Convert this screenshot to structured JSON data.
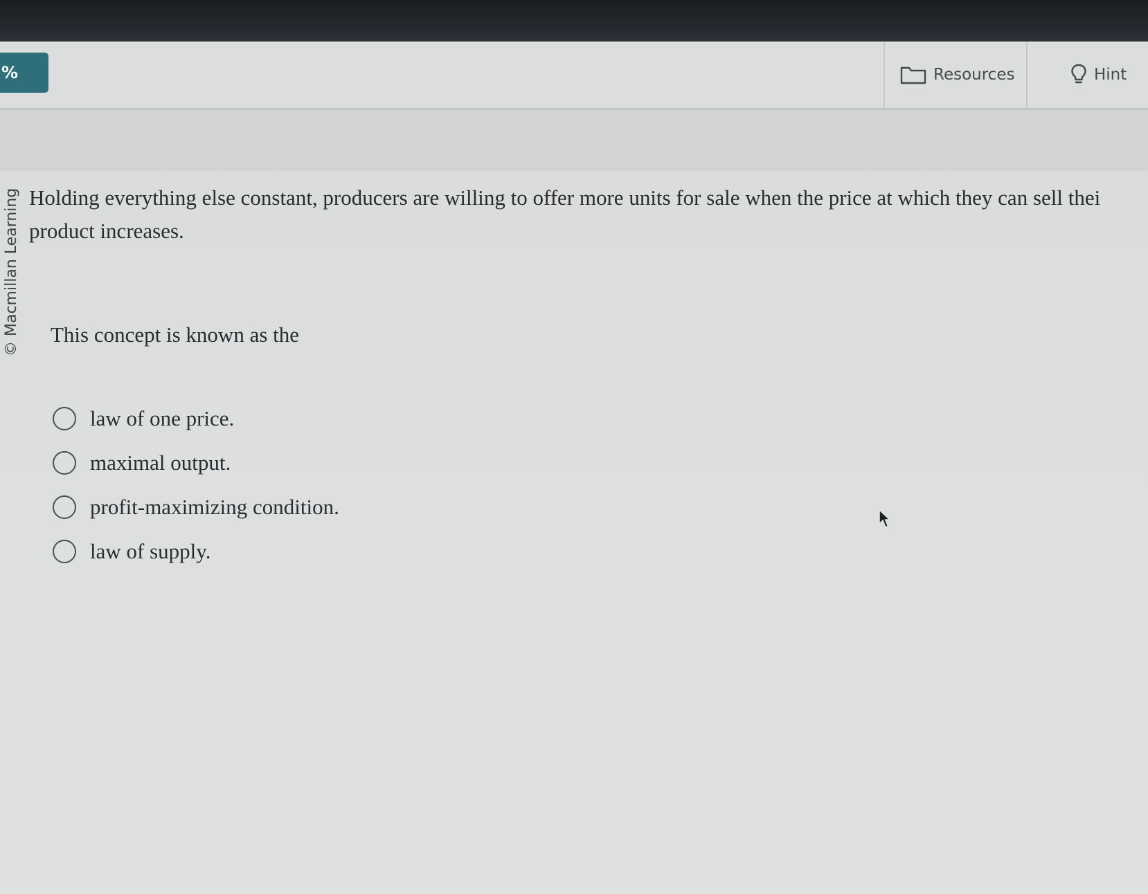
{
  "toolbar": {
    "score_label": "%",
    "resources_label": "Resources",
    "resources_icon": "folder-icon",
    "hint_label": "Hint",
    "hint_icon": "lightbulb-icon"
  },
  "credit": "© Macmillan Learning",
  "question": {
    "text": "Holding everything else constant, producers are willing to offer more units for sale when the price at which they can sell thei product increases.",
    "prompt": "This concept is known as the"
  },
  "options": [
    {
      "label": "law of one price.",
      "selected": false
    },
    {
      "label": "maximal output.",
      "selected": false
    },
    {
      "label": "profit-maximizing condition.",
      "selected": false
    },
    {
      "label": "law of supply.",
      "selected": false
    }
  ],
  "colors": {
    "accent": "#2e6f7a",
    "page_background": "#dcdede",
    "text": "#2a2d2f"
  }
}
